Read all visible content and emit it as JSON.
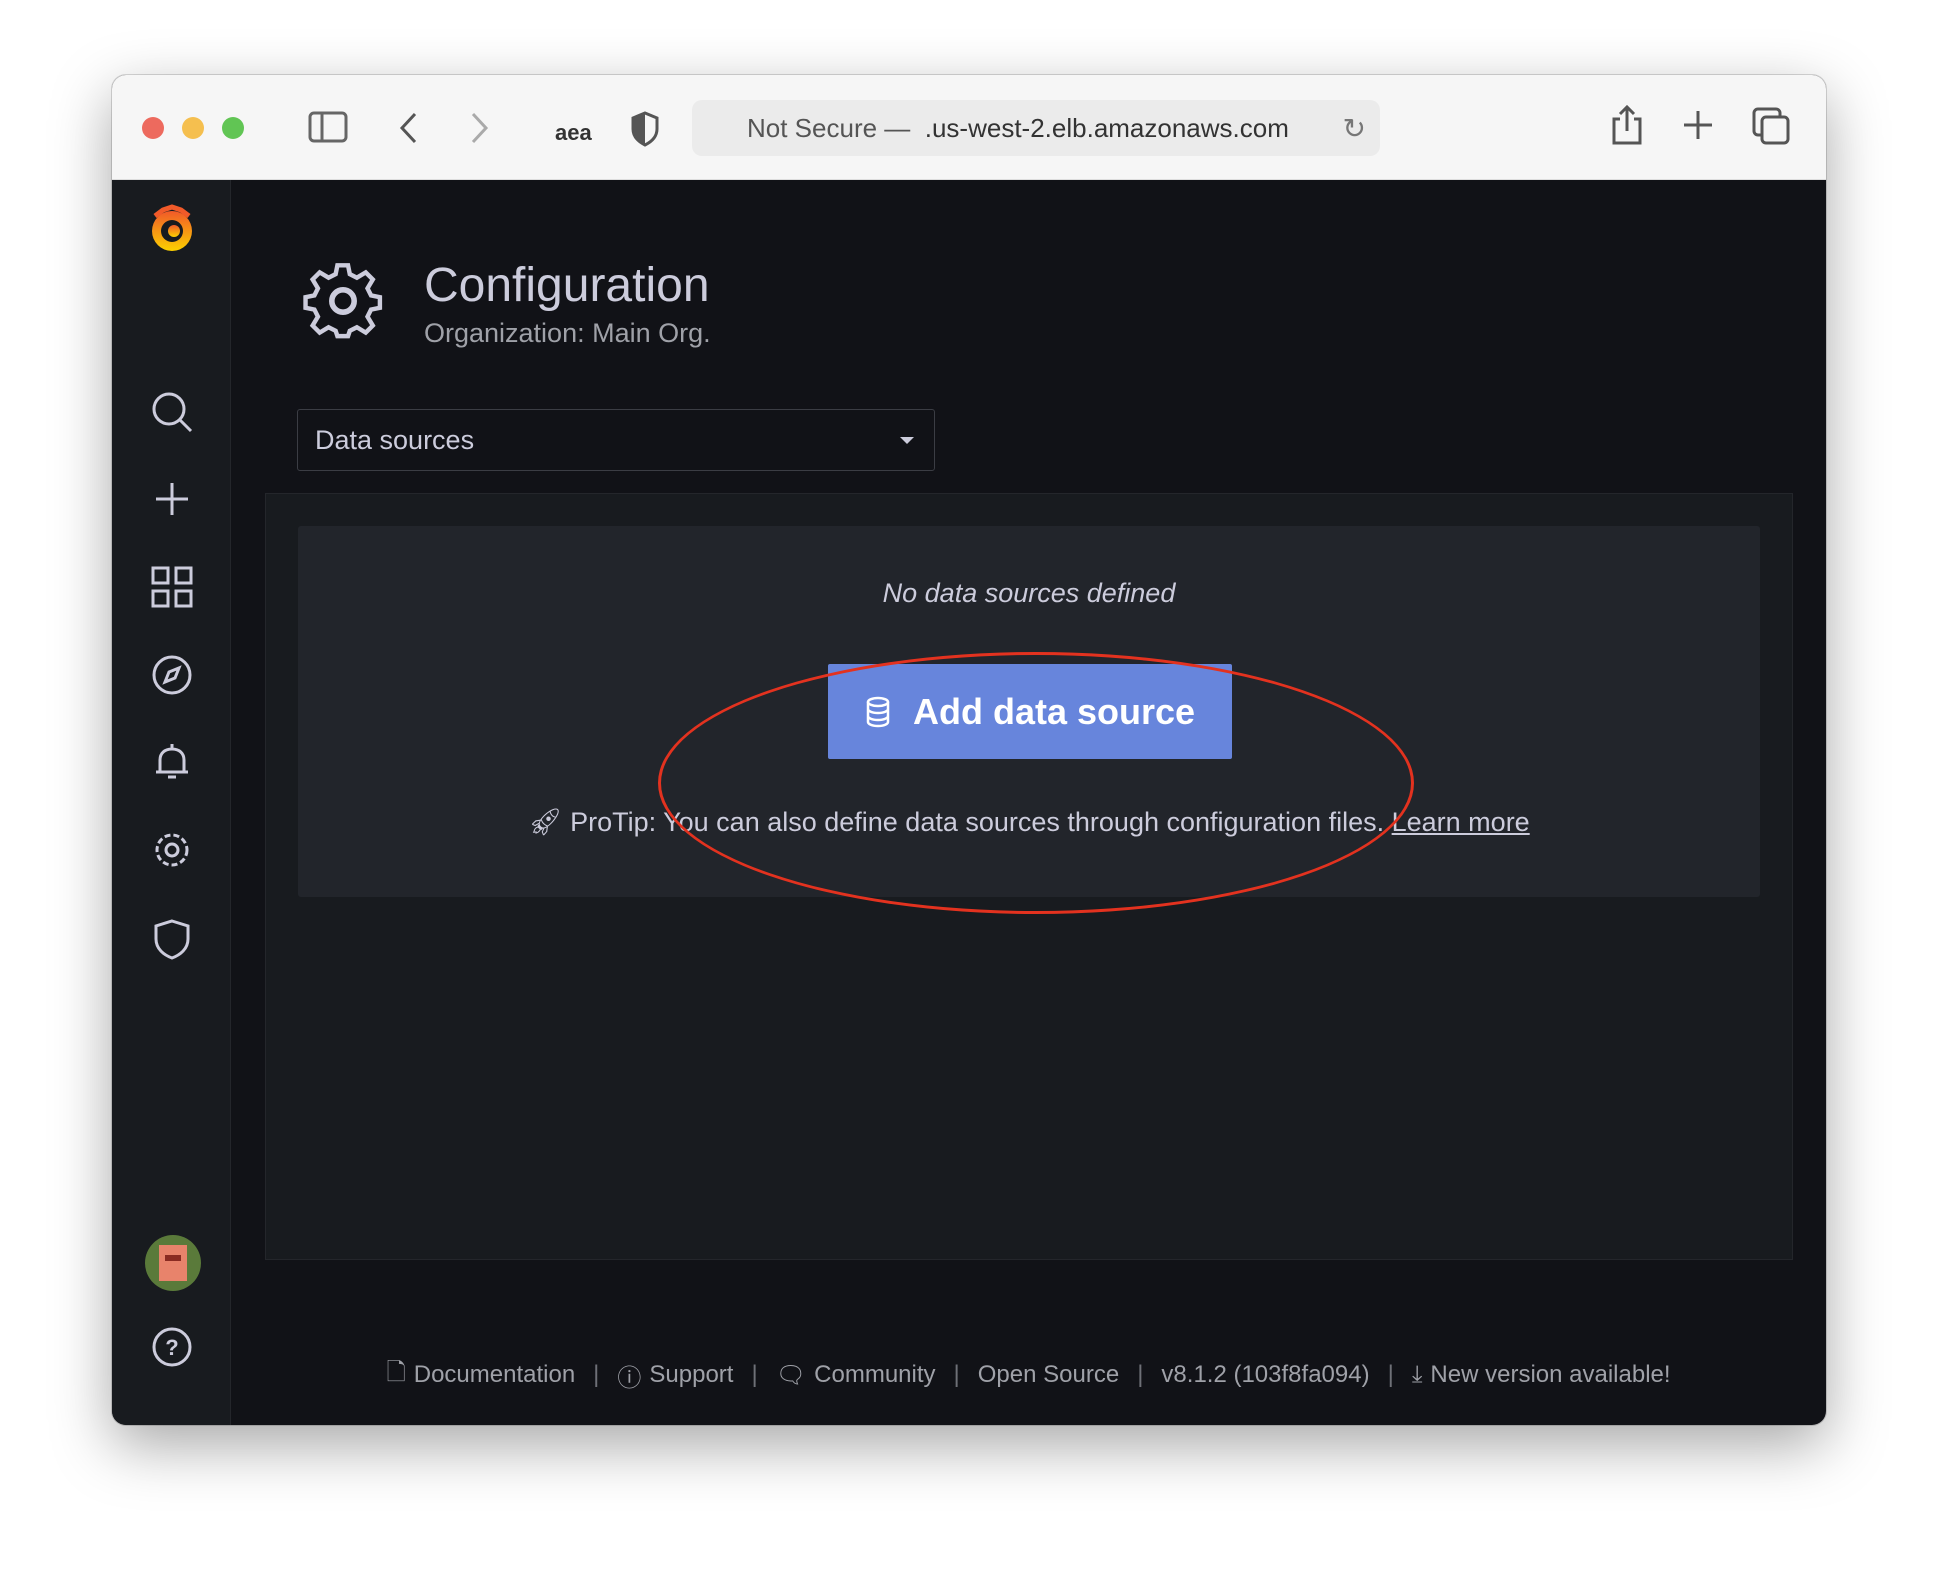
{
  "browser": {
    "url_prefix": "Not Secure —",
    "url_host": ".us-west-2.elb.amazonaws.com",
    "extension_label": "aea"
  },
  "header": {
    "title": "Configuration",
    "subtitle": "Organization: Main Org."
  },
  "section_select": {
    "value": "Data sources"
  },
  "empty_state": {
    "message": "No data sources defined",
    "button_label": "Add data source",
    "protip": "ProTip: You can also define data sources through configuration files.",
    "learn_more": "Learn more"
  },
  "footer": {
    "items": [
      "Documentation",
      "Support",
      "Community",
      "Open Source",
      "v8.1.2 (103f8fa094)",
      "New version available!"
    ]
  },
  "colors": {
    "accent": "#6785dc",
    "annotation": "#e3321f",
    "background": "#111217"
  }
}
